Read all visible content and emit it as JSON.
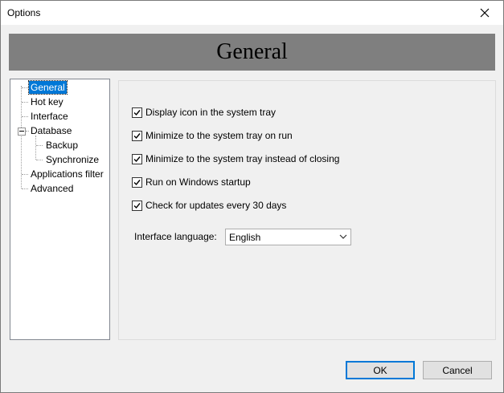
{
  "window": {
    "title": "Options",
    "close_icon": "close-icon"
  },
  "banner": {
    "title": "General"
  },
  "tree": {
    "items": [
      {
        "label": "General",
        "selected": true
      },
      {
        "label": "Hot key"
      },
      {
        "label": "Interface"
      },
      {
        "label": "Database",
        "expanded": true
      },
      {
        "label": "Backup"
      },
      {
        "label": "Synchronize"
      },
      {
        "label": "Applications filter"
      },
      {
        "label": "Advanced"
      }
    ]
  },
  "panel": {
    "checkboxes": [
      {
        "label": "Display icon in the system tray",
        "checked": true
      },
      {
        "label": "Minimize to the system tray on run",
        "checked": true
      },
      {
        "label": "Minimize to the system tray instead of closing",
        "checked": true
      },
      {
        "label": "Run on Windows startup",
        "checked": true
      },
      {
        "label": "Check for updates every 30 days",
        "checked": true
      }
    ],
    "language_label": "Interface language:",
    "language_value": "English"
  },
  "buttons": {
    "ok": "OK",
    "cancel": "Cancel"
  },
  "colors": {
    "selection": "#0078d7",
    "banner": "#7f7f7f"
  }
}
